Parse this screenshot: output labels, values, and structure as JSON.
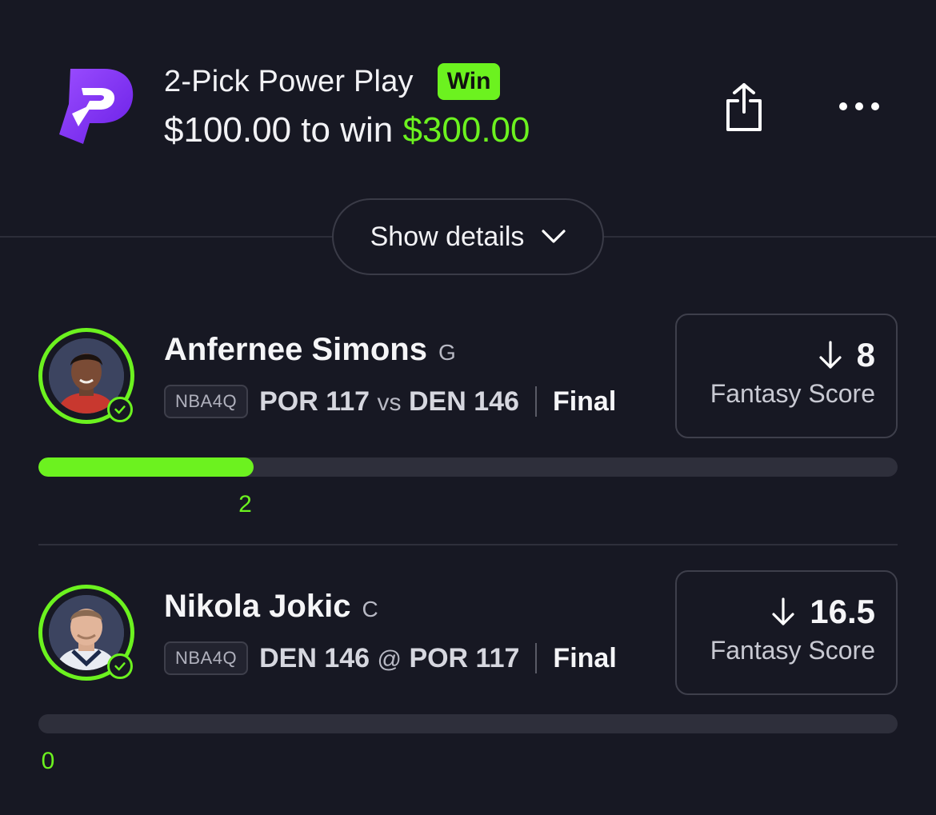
{
  "header": {
    "title": "2-Pick Power Play",
    "badge": "Win",
    "stake_text": "$100.00 to win ",
    "payout": "$300.00",
    "share_icon": "share-icon",
    "more_icon": "more-horizontal-icon",
    "logo": "prizepicks-logo"
  },
  "details_button": {
    "label": "Show details",
    "icon": "chevron-down-icon"
  },
  "colors": {
    "background": "#171823",
    "accent": "#6cf21f",
    "track": "#2e2f3b"
  },
  "picks": [
    {
      "name": "Anfernee Simons",
      "position": "G",
      "league": "NBA4Q",
      "team1": "POR 117",
      "separator": "vs",
      "team2": "DEN 146",
      "status": "Final",
      "direction_icon": "arrow-down-icon",
      "line": "8",
      "stat_label": "Fantasy Score",
      "actual": "2",
      "progress": 0.25,
      "result": "hit"
    },
    {
      "name": "Nikola Jokic",
      "position": "C",
      "league": "NBA4Q",
      "team1": "DEN 146",
      "separator": "@",
      "team2": "POR 117",
      "status": "Final",
      "direction_icon": "arrow-down-icon",
      "line": "16.5",
      "stat_label": "Fantasy Score",
      "actual": "0",
      "progress": 0,
      "result": "hit"
    }
  ]
}
